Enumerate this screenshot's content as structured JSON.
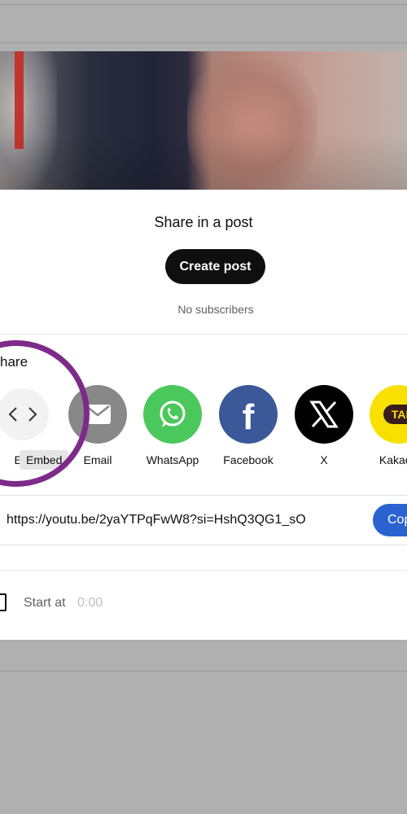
{
  "dialog": {
    "title": "Share in a post",
    "create_post_label": "Create post",
    "subscribers_text": "No subscribers",
    "share_label": "hare"
  },
  "share_targets": [
    {
      "label": "Em",
      "icon": "embed-icon",
      "color": "#f2f2f2"
    },
    {
      "label": "Email",
      "icon": "email-icon",
      "color": "#888888"
    },
    {
      "label": "WhatsApp",
      "icon": "whatsapp-icon",
      "color": "#25d366"
    },
    {
      "label": "Facebook",
      "icon": "facebook-icon",
      "color": "#3b5998"
    },
    {
      "label": "X",
      "icon": "x-icon",
      "color": "#000000"
    },
    {
      "label": "KakaoT",
      "icon": "kakaotalk-icon",
      "color": "#f9e000"
    }
  ],
  "tooltip": {
    "text": "Embed"
  },
  "link": {
    "url": "https://youtu.be/2yaYTPqFwW8?si=HshQ3QG1_sO",
    "copy_label": "Cop"
  },
  "start_at": {
    "label": "Start at",
    "value": "0:00"
  },
  "colors": {
    "highlight_ring": "#7e2a8a",
    "copy_button": "#2a63d0",
    "create_button": "#0f0f0f"
  }
}
